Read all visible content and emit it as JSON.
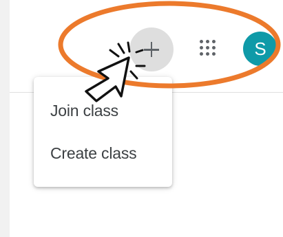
{
  "header": {
    "add_icon": "plus-icon",
    "apps_icon": "apps-grid-icon",
    "avatar_initial": "S",
    "avatar_color": "#0f9aa8"
  },
  "menu": {
    "items": [
      {
        "label": "Join class"
      },
      {
        "label": "Create class"
      }
    ]
  },
  "annotation": {
    "highlight_color": "#ec7a2c",
    "cursor_icon": "pointer-arrow-icon"
  }
}
